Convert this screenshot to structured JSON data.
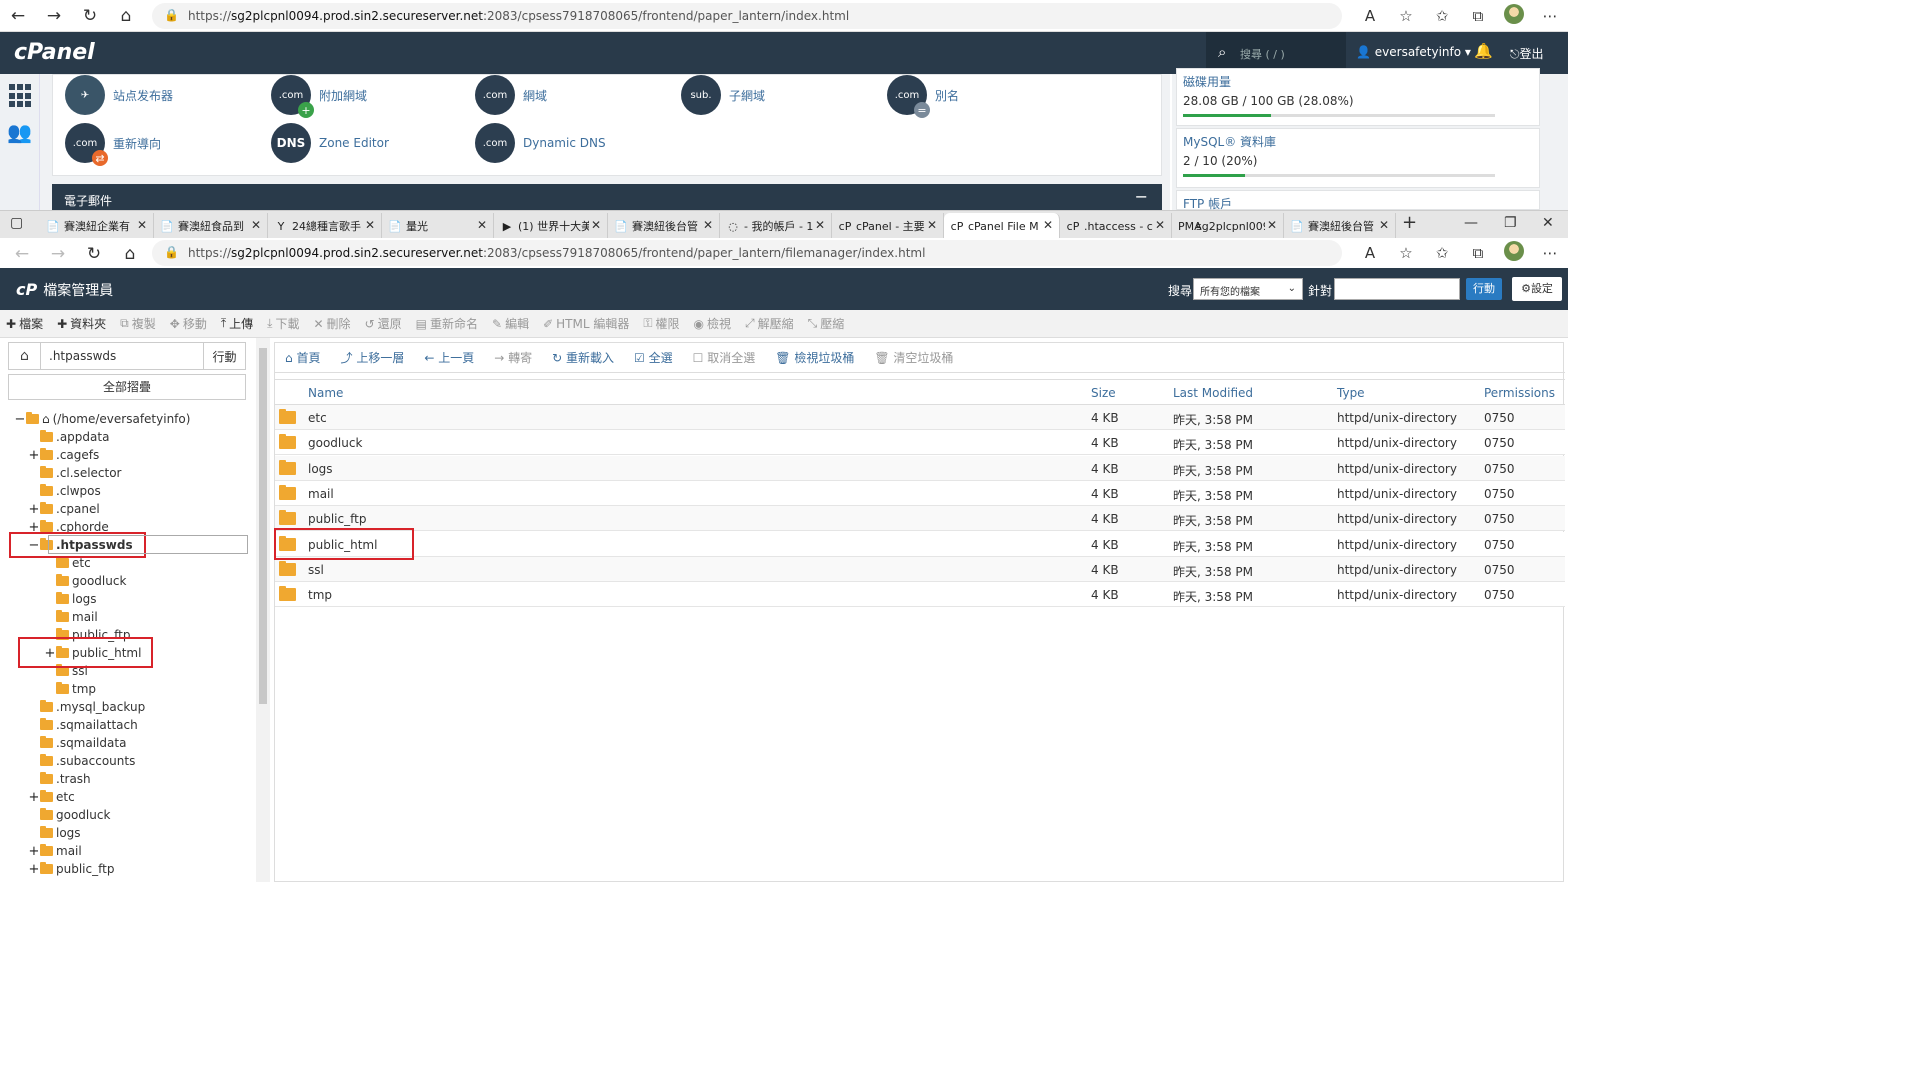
{
  "browser_top": {
    "url_prefix": "https://",
    "url_host": "sg2plcpnl0094.prod.sin2.secureserver.net",
    "url_rest": ":2083/cpsess7918708065/frontend/paper_lantern/index.html"
  },
  "cpanel": {
    "logo": "cPanel",
    "search_placeholder": "搜尋 ( / )",
    "user": "eversafetyinfo",
    "logout": "登出",
    "domains": [
      {
        "label": "站点发布器",
        "icon": "✈"
      },
      {
        "label": "附加網域",
        "icon": ".com"
      },
      {
        "label": "網域",
        "icon": ".com"
      },
      {
        "label": "子網域",
        "icon": "sub."
      },
      {
        "label": "別名",
        "icon": ".com"
      },
      {
        "label": "重新導向",
        "icon": ".com"
      },
      {
        "label": "Zone Editor",
        "icon": "DNS"
      },
      {
        "label": "Dynamic DNS",
        "icon": ".com"
      }
    ],
    "email_section": "電子郵件",
    "stats": [
      {
        "label": "磁碟用量",
        "value": "28.08 GB / 100 GB  (28.08%)",
        "percent": 28.08
      },
      {
        "label": "MySQL® 資料庫",
        "value": "2 / 10  (20%)",
        "percent": 20
      },
      {
        "label": "FTP 帳戶",
        "value": ""
      }
    ]
  },
  "tabs": [
    {
      "title": "賽澳紐企業有",
      "icon": "📄"
    },
    {
      "title": "賽澳紐食品到",
      "icon": "📄"
    },
    {
      "title": "24總種言歌手",
      "icon": "Y"
    },
    {
      "title": "量光",
      "icon": "📄"
    },
    {
      "title": "(1) 世界十大美",
      "icon": "▶"
    },
    {
      "title": "賽澳紐後台管",
      "icon": "📄"
    },
    {
      "title": "- 我的帳戶 - 1",
      "icon": "◌"
    },
    {
      "title": "cPanel - 主要",
      "icon": "cP"
    },
    {
      "title": "cPanel File M",
      "icon": "cP"
    },
    {
      "title": ".htaccess - cP",
      "icon": "cP"
    },
    {
      "title": "sg2plcpnl009",
      "icon": "PMA"
    },
    {
      "title": "賽澳紐後台管",
      "icon": "📄"
    }
  ],
  "browser_bottom": {
    "url_prefix": "https://",
    "url_host": "sg2plcpnl0094.prod.sin2.secureserver.net",
    "url_rest": ":2083/cpsess7918708065/frontend/paper_lantern/filemanager/index.html"
  },
  "fm": {
    "title": "檔案管理員",
    "logo": "cP",
    "search_label": "搜尋",
    "search_scope": "所有您的檔案",
    "for_label": "針對",
    "go": "行動",
    "settings": "設定",
    "toolbar": [
      {
        "label": "檔案",
        "icon": "✚",
        "on": true
      },
      {
        "label": "資料夾",
        "icon": "✚",
        "on": true
      },
      {
        "label": "複製",
        "icon": "⧉",
        "on": false
      },
      {
        "label": "移動",
        "icon": "✥",
        "on": false
      },
      {
        "label": "上傳",
        "icon": "⤒",
        "on": true
      },
      {
        "label": "下載",
        "icon": "⤓",
        "on": false
      },
      {
        "label": "刪除",
        "icon": "✕",
        "on": false
      },
      {
        "label": "還原",
        "icon": "↺",
        "on": false
      },
      {
        "label": "重新命名",
        "icon": "▤",
        "on": false
      },
      {
        "label": "編輯",
        "icon": "✎",
        "on": false
      },
      {
        "label": "HTML 編輯器",
        "icon": "✐",
        "on": false
      },
      {
        "label": "權限",
        "icon": "⚿",
        "on": false
      },
      {
        "label": "檢視",
        "icon": "◉",
        "on": false
      },
      {
        "label": "解壓縮",
        "icon": "⤢",
        "on": false
      },
      {
        "label": "壓縮",
        "icon": "⤡",
        "on": false
      }
    ],
    "path_value": ".htpasswds",
    "path_go": "行動",
    "collapse_all": "全部摺疊",
    "tree": [
      {
        "label": "(/home/eversafetyinfo)",
        "pm": "−",
        "indent": 0,
        "home": true
      },
      {
        "label": ".appdata",
        "pm": "",
        "indent": 1
      },
      {
        "label": ".cagefs",
        "pm": "+",
        "indent": 1
      },
      {
        "label": ".cl.selector",
        "pm": "",
        "indent": 1
      },
      {
        "label": ".clwpos",
        "pm": "",
        "indent": 1
      },
      {
        "label": ".cpanel",
        "pm": "+",
        "indent": 1
      },
      {
        "label": ".cphorde",
        "pm": "+",
        "indent": 1
      },
      {
        "label": ".htpasswds",
        "pm": "−",
        "indent": 1,
        "bold": true
      },
      {
        "label": "etc",
        "pm": "",
        "indent": 2
      },
      {
        "label": "goodluck",
        "pm": "",
        "indent": 2
      },
      {
        "label": "logs",
        "pm": "",
        "indent": 2
      },
      {
        "label": "mail",
        "pm": "",
        "indent": 2
      },
      {
        "label": "public_ftp",
        "pm": "",
        "indent": 2
      },
      {
        "label": "public_html",
        "pm": "+",
        "indent": 2
      },
      {
        "label": "ssl",
        "pm": "",
        "indent": 2
      },
      {
        "label": "tmp",
        "pm": "",
        "indent": 2
      },
      {
        "label": ".mysql_backup",
        "pm": "",
        "indent": 1
      },
      {
        "label": ".sqmailattach",
        "pm": "",
        "indent": 1
      },
      {
        "label": ".sqmaildata",
        "pm": "",
        "indent": 1
      },
      {
        "label": ".subaccounts",
        "pm": "",
        "indent": 1
      },
      {
        "label": ".trash",
        "pm": "",
        "indent": 1
      },
      {
        "label": "etc",
        "pm": "+",
        "indent": 1
      },
      {
        "label": "goodluck",
        "pm": "",
        "indent": 1
      },
      {
        "label": "logs",
        "pm": "",
        "indent": 1
      },
      {
        "label": "mail",
        "pm": "+",
        "indent": 1
      },
      {
        "label": "public_ftp",
        "pm": "+",
        "indent": 1
      }
    ],
    "nav": [
      {
        "label": "首頁",
        "icon": "⌂",
        "on": true
      },
      {
        "label": "上移一層",
        "icon": "⤴",
        "on": true
      },
      {
        "label": "上一頁",
        "icon": "←",
        "on": true
      },
      {
        "label": "轉寄",
        "icon": "→",
        "on": false
      },
      {
        "label": "重新載入",
        "icon": "↻",
        "on": true
      },
      {
        "label": "全選",
        "icon": "☑",
        "on": true
      },
      {
        "label": "取消全選",
        "icon": "☐",
        "on": false
      },
      {
        "label": "檢視垃圾桶",
        "icon": "🗑",
        "on": true
      },
      {
        "label": "清空垃圾桶",
        "icon": "🗑",
        "on": false
      }
    ],
    "columns": {
      "name": "Name",
      "size": "Size",
      "modified": "Last Modified",
      "type": "Type",
      "perms": "Permissions"
    },
    "rows": [
      {
        "name": "etc",
        "size": "4 KB",
        "modified": "昨天, 3:58 PM",
        "type": "httpd/unix-directory",
        "perms": "0750"
      },
      {
        "name": "goodluck",
        "size": "4 KB",
        "modified": "昨天, 3:58 PM",
        "type": "httpd/unix-directory",
        "perms": "0750"
      },
      {
        "name": "logs",
        "size": "4 KB",
        "modified": "昨天, 3:58 PM",
        "type": "httpd/unix-directory",
        "perms": "0750"
      },
      {
        "name": "mail",
        "size": "4 KB",
        "modified": "昨天, 3:58 PM",
        "type": "httpd/unix-directory",
        "perms": "0750"
      },
      {
        "name": "public_ftp",
        "size": "4 KB",
        "modified": "昨天, 3:58 PM",
        "type": "httpd/unix-directory",
        "perms": "0750"
      },
      {
        "name": "public_html",
        "size": "4 KB",
        "modified": "昨天, 3:58 PM",
        "type": "httpd/unix-directory",
        "perms": "0750"
      },
      {
        "name": "ssl",
        "size": "4 KB",
        "modified": "昨天, 3:58 PM",
        "type": "httpd/unix-directory",
        "perms": "0750"
      },
      {
        "name": "tmp",
        "size": "4 KB",
        "modified": "昨天, 3:58 PM",
        "type": "httpd/unix-directory",
        "perms": "0750"
      }
    ]
  }
}
